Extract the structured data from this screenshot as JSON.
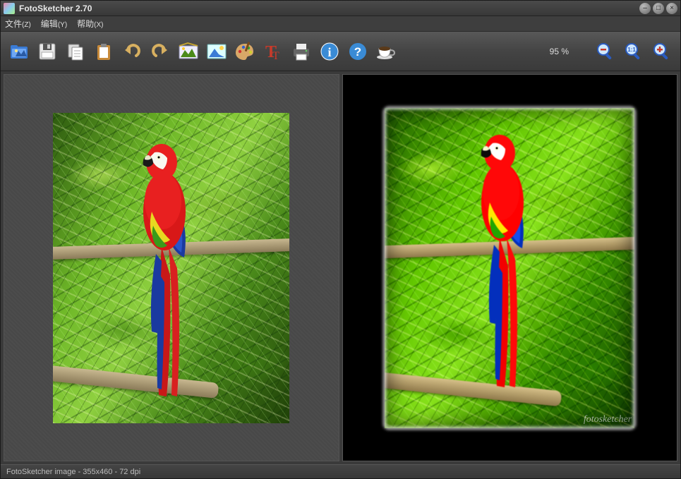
{
  "window": {
    "title": "FotoSketcher 2.70"
  },
  "menu": {
    "file": "文件",
    "file_accel": "(Z)",
    "edit": "编辑",
    "edit_accel": "(Y)",
    "help": "帮助",
    "help_accel": "(X)"
  },
  "toolbar": {
    "icons": {
      "open": "open-folder-icon",
      "save": "save-icon",
      "copy": "copy-icon",
      "paste": "paste-icon",
      "undo": "undo-icon",
      "redo": "redo-icon",
      "params": "parameters-icon",
      "retouch": "retouch-icon",
      "palette": "palette-icon",
      "text": "text-tool-icon",
      "print": "print-icon",
      "info": "info-icon",
      "about": "help-icon",
      "donate": "coffee-icon",
      "zoom_out": "zoom-out-icon",
      "zoom_fit": "zoom-fit-icon",
      "zoom_in": "zoom-in-icon"
    },
    "zoom_label": "95 %"
  },
  "output": {
    "watermark": "fotosketcher"
  },
  "statusbar": {
    "text": "FotoSketcher image - 355x460 - 72 dpi"
  }
}
